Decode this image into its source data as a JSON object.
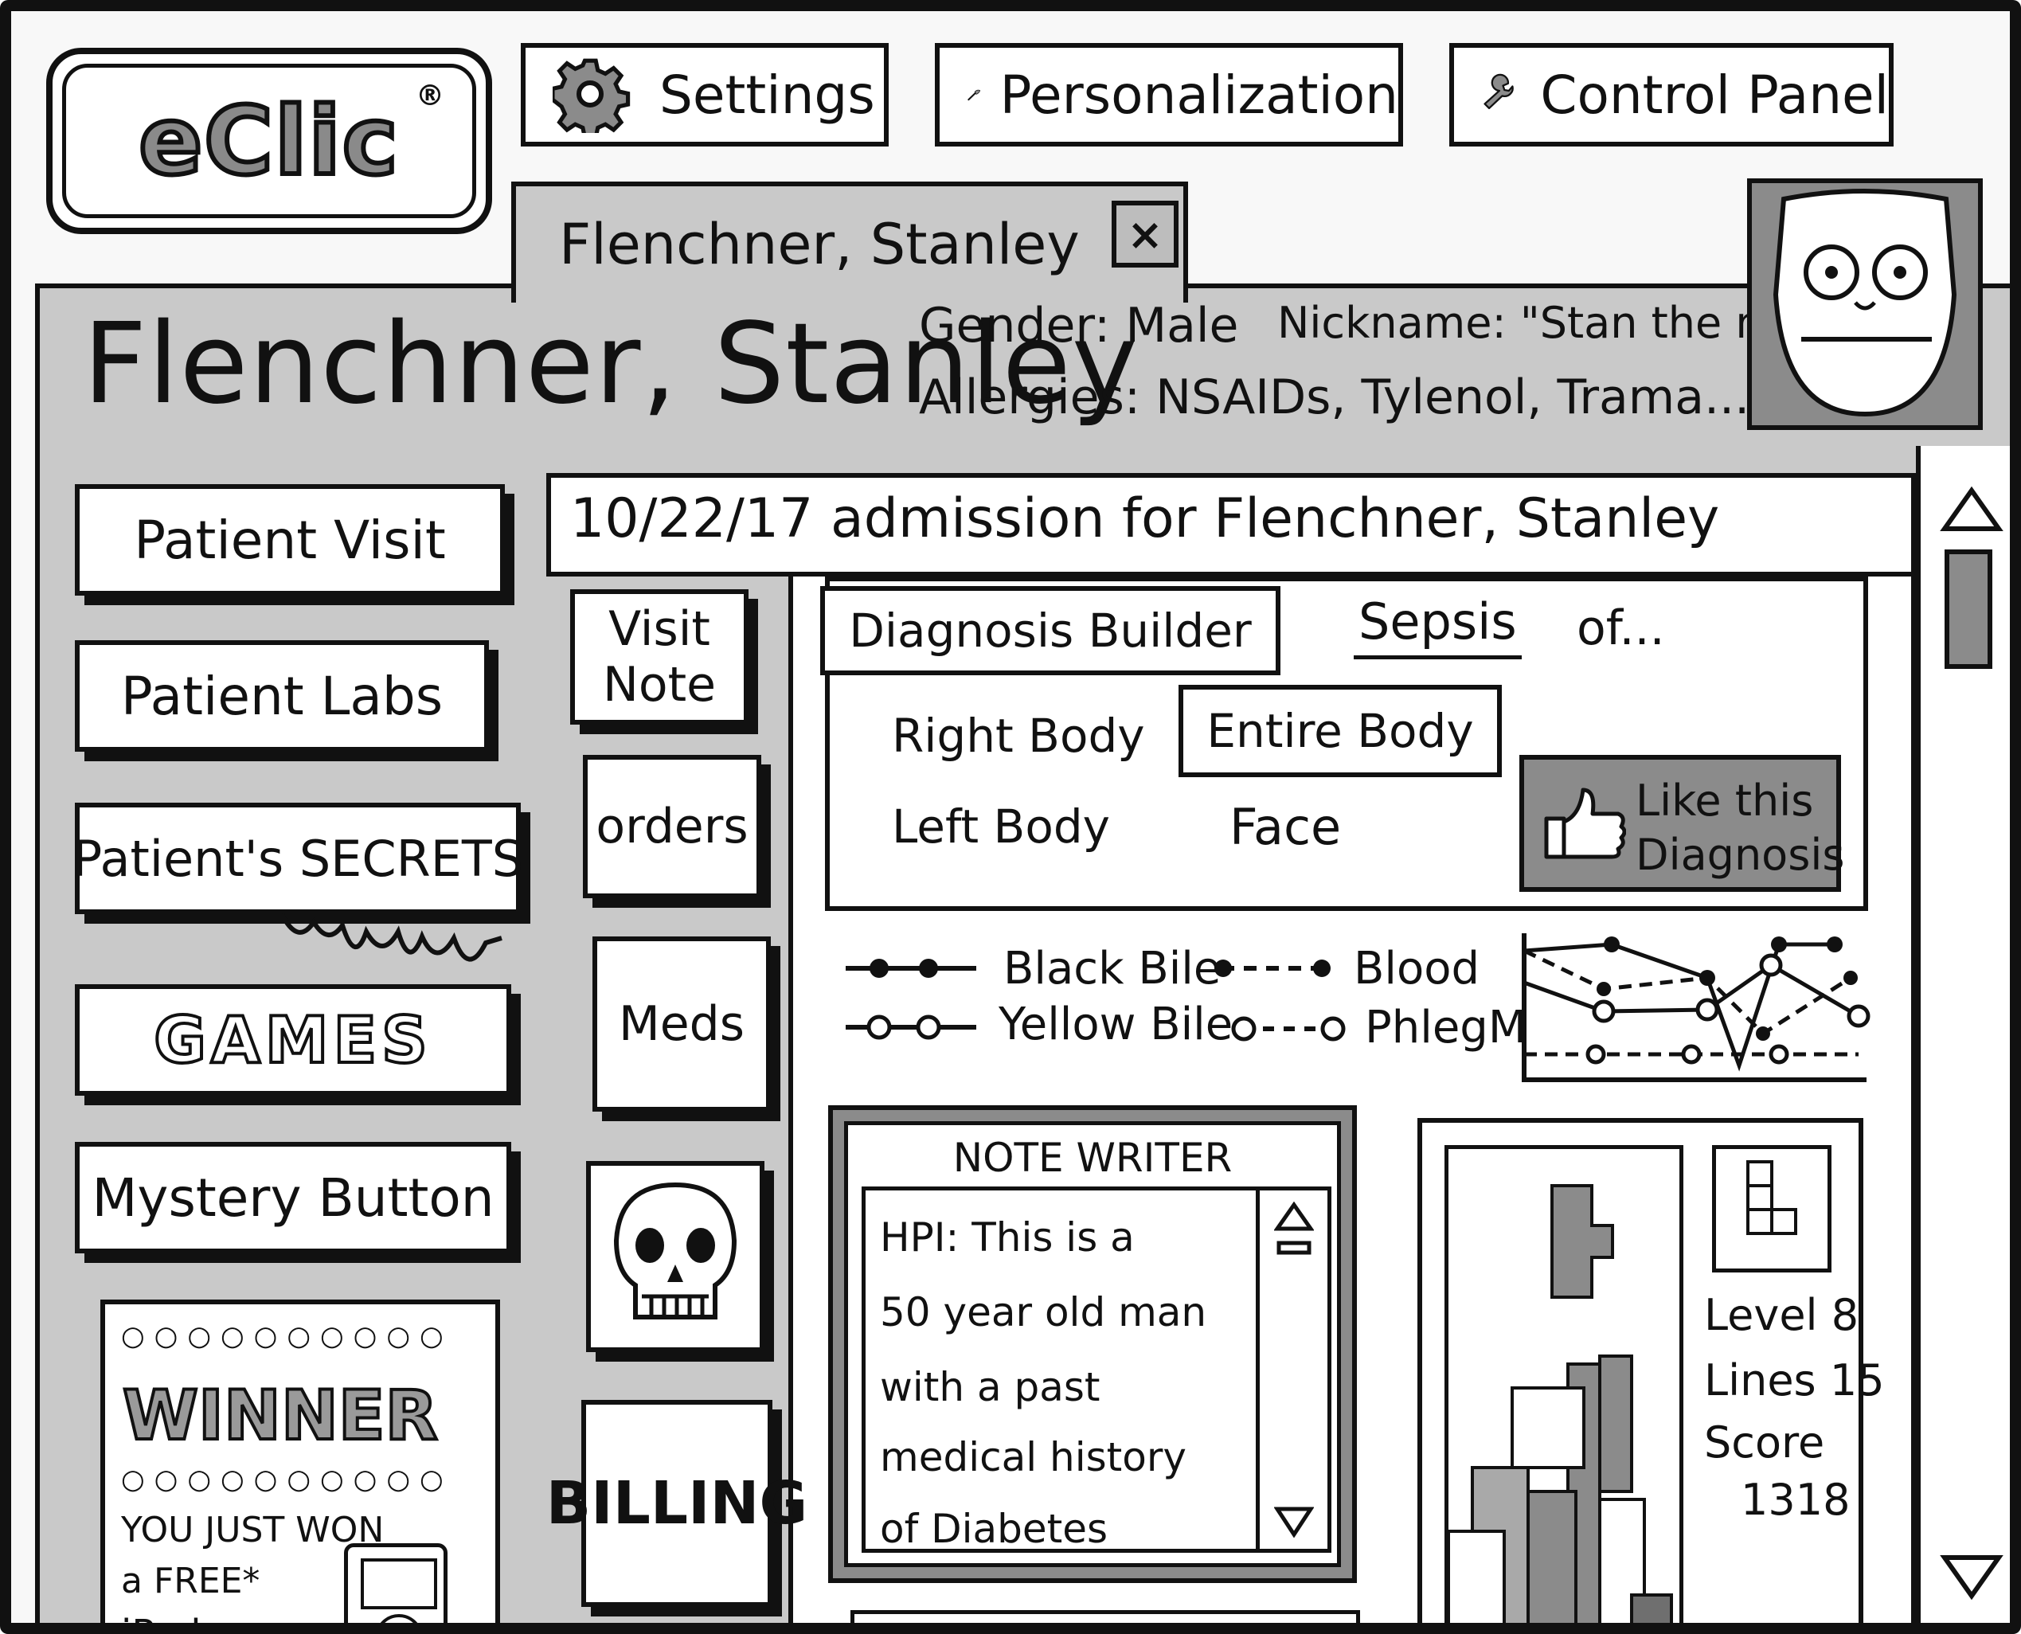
{
  "app": {
    "logo": "eClic",
    "logo_mark": "®"
  },
  "toolbar": {
    "settings_label": "Settings",
    "personalization_label": "Personalization",
    "control_panel_label": "Control Panel"
  },
  "tab": {
    "label": "Flenchner, Stanley",
    "close_glyph": "×"
  },
  "patient": {
    "name": "Flenchner, Stanley",
    "gender": "Gender: Male",
    "nickname": "Nickname: \"Stan the man\"",
    "allergies": "Allergies: NSAIDs, Tylenol, Trama...."
  },
  "sidebar": {
    "items": [
      {
        "label": "Patient Visit"
      },
      {
        "label": "Patient Labs"
      },
      {
        "label": "Patient's SECRETS"
      },
      {
        "label": "GAMES"
      },
      {
        "label": "Mystery Button"
      }
    ],
    "ad": {
      "headline": "WINNER",
      "line1": "YOU JUST WON",
      "line2": "a FREE*",
      "line3": "iPod"
    }
  },
  "main": {
    "title": "10/22/17  admission for Flenchner, Stanley",
    "vtabs": [
      {
        "label": "Visit Note"
      },
      {
        "label": "orders"
      },
      {
        "label": "Meds"
      },
      {
        "label": "skull-icon"
      },
      {
        "label": "BILLING"
      }
    ]
  },
  "diagnosis": {
    "builder_label": "Diagnosis Builder",
    "diagnosis_value": "Sepsis",
    "of_text": "of...",
    "options": [
      "Right Body",
      "Entire Body",
      "Left Body",
      "Face"
    ],
    "selected_option": "Entire Body",
    "like_label_1": "Like this",
    "like_label_2": "Diagnosis"
  },
  "humors": {
    "legend": [
      "Black Bile",
      "Blood",
      "Yellow Bile",
      "PhlegM"
    ]
  },
  "note_writer": {
    "title": "NOTE WRITER",
    "lines": [
      "HPI: This  is  a",
      "50 year old man",
      "with  a  past",
      "medical  history",
      "of  Diabetes"
    ]
  },
  "game": {
    "level": "Level 8",
    "lines": "Lines 15",
    "score_label": "Score",
    "score_value": "1318"
  },
  "colors": {
    "band": "#c9c9c9",
    "dark": "#8b8b8b",
    "ink": "#111111"
  }
}
